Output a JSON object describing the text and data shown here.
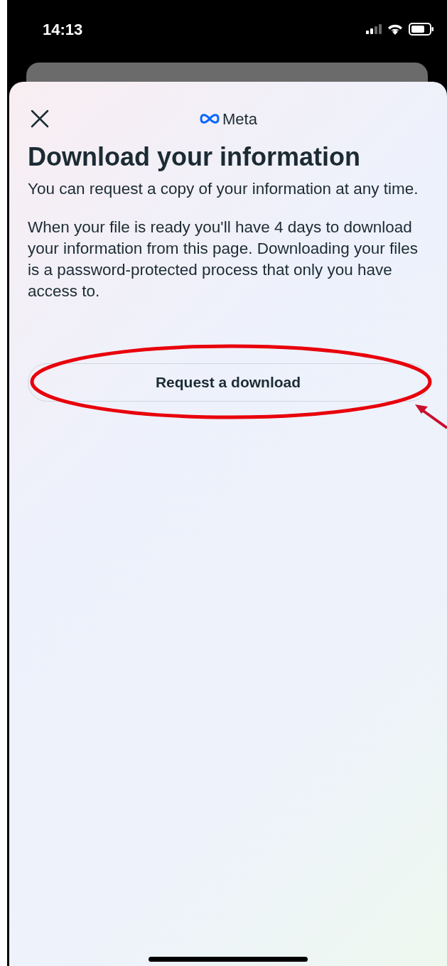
{
  "status_bar": {
    "time": "14:13"
  },
  "sheet": {
    "logo": "Meta",
    "title": "Download your information",
    "paragraphs": [
      "You can request a copy of your information at any time.",
      "When your file is ready you'll have 4 days to download your information from this page. Downloading your files is a password-protected process that only you have access to."
    ],
    "button": "Request a download"
  }
}
